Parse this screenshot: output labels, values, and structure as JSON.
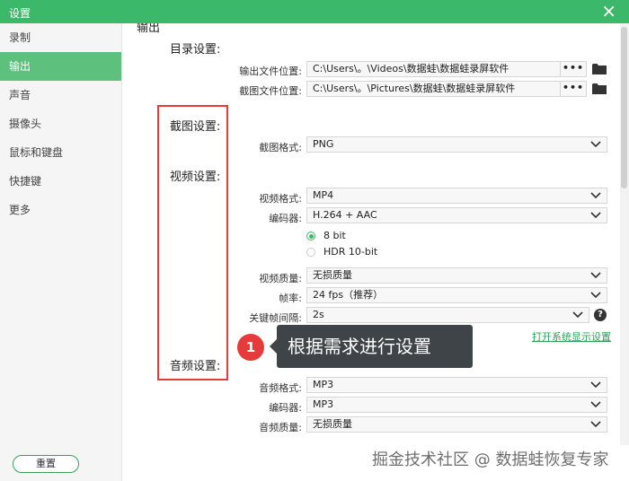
{
  "window": {
    "title": "设置",
    "close_glyph": "×"
  },
  "sidebar": {
    "items": [
      {
        "label": "录制",
        "active": false
      },
      {
        "label": "输出",
        "active": true
      },
      {
        "label": "声音",
        "active": false
      },
      {
        "label": "摄像头",
        "active": false
      },
      {
        "label": "鼠标和键盘",
        "active": false
      },
      {
        "label": "快捷键",
        "active": false
      },
      {
        "label": "更多",
        "active": false
      }
    ],
    "reset_label": "重置"
  },
  "main": {
    "section_title": "输出",
    "dir_settings": {
      "heading": "目录设置:",
      "output_label": "输出文件位置:",
      "output_path": "C:\\Users\\。\\Videos\\数据蛙\\数据蛙录屏软件",
      "screenshot_label": "截图文件位置:",
      "screenshot_path": "C:\\Users\\。\\Pictures\\数据蛙\\数据蛙录屏软件",
      "dots": "•••"
    },
    "screenshot_settings": {
      "heading": "截图设置:",
      "format_label": "截图格式:",
      "format_value": "PNG"
    },
    "video_settings": {
      "heading": "视频设置:",
      "format_label": "视频格式:",
      "format_value": "MP4",
      "encoder_label": "编码器:",
      "encoder_value": "H.264 + AAC",
      "bitdepth_options": [
        "8 bit",
        "HDR 10-bit"
      ],
      "bitdepth_selected": "8 bit",
      "quality_label": "视频质量:",
      "quality_value": "无损质量",
      "fps_label": "帧率:",
      "fps_value": "24 fps（推荐）",
      "keyframe_label": "关键帧间隔:",
      "keyframe_value": "2s",
      "help_glyph": "?",
      "system_link": "打开系统显示设置"
    },
    "audio_settings": {
      "heading": "音频设置:",
      "format_label": "音频格式:",
      "format_value": "MP3",
      "encoder_label": "编码器:",
      "encoder_value": "MP3",
      "quality_label": "音频质量:",
      "quality_value": "无损质量"
    }
  },
  "annotation": {
    "marker": "1",
    "tooltip": "根据需求进行设置",
    "color": "#e53b3b"
  },
  "watermark": "掘金技术社区 @ 数据蛙恢复专家",
  "colors": {
    "accent": "#3cb86a",
    "active_nav": "#5dc07d",
    "link": "#2f9e58"
  }
}
